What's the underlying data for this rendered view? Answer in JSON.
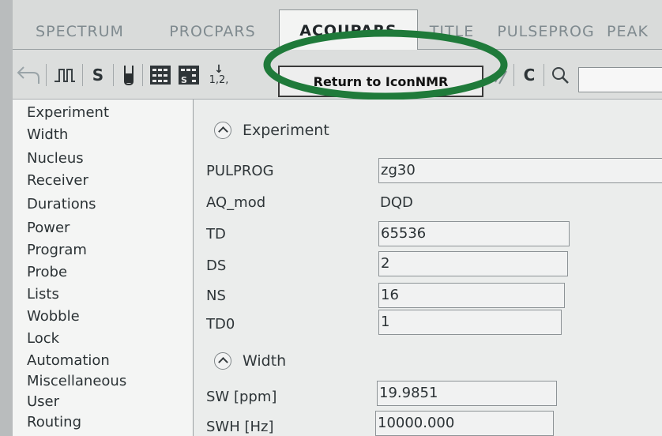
{
  "tabs": [
    {
      "label": "SPECTRUM"
    },
    {
      "label": "PROCPARS"
    },
    {
      "label": "ACQUPARS"
    },
    {
      "label": "TITLE"
    },
    {
      "label": "PULSEPROG"
    },
    {
      "label": "PEAK"
    }
  ],
  "toolbar": {
    "s_label": "S",
    "s2_label": "S",
    "sort_label": "1,2,",
    "return_label": "Return to IconNMR",
    "c_label": "C",
    "search_value": ""
  },
  "nav": [
    "Experiment",
    "Width",
    "Nucleus",
    "Receiver",
    "Durations",
    "Power",
    "Program",
    "Probe",
    "Lists",
    "Wobble",
    "Lock",
    "Automation",
    "Miscellaneous",
    "User",
    "Routing"
  ],
  "experiment": {
    "heading": "Experiment",
    "params": [
      {
        "label": "PULPROG",
        "value": "zg30"
      },
      {
        "label": "AQ_mod",
        "value": "DQD"
      },
      {
        "label": "TD",
        "value": "65536"
      },
      {
        "label": "DS",
        "value": "2"
      },
      {
        "label": "NS",
        "value": "16"
      },
      {
        "label": "TD0",
        "value": "1"
      }
    ]
  },
  "width": {
    "heading": "Width",
    "params": [
      {
        "label": "SW [ppm]",
        "value": "19.9851"
      },
      {
        "label": "SWH [Hz]",
        "value": "10000.000"
      }
    ]
  },
  "colors": {
    "highlight_oval": "#1f7a3a"
  }
}
